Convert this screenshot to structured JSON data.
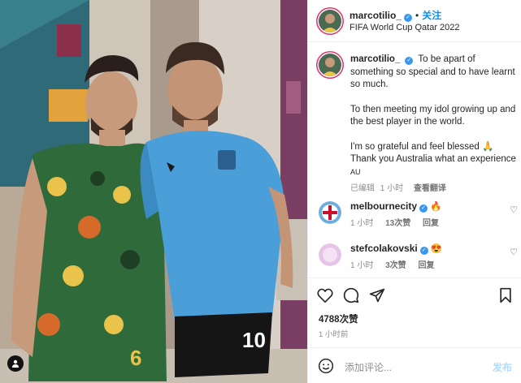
{
  "post": {
    "username": "marcotilio_",
    "follow_label": "关注",
    "location": "FIFA World Cup Qatar 2022",
    "jersey_number": "10"
  },
  "caption": {
    "username": "marcotilio_",
    "line1": "To be apart of something so special and to have learnt so much.",
    "line2": "To then meeting my idol growing up and the best player in the world.",
    "line3": "I'm so grateful and feel blessed",
    "line3_emoji": "🙏",
    "line4": "Thank you Australia what an experience",
    "line4_flag": "AU",
    "edited": "已编辑",
    "time": "1 小时",
    "translate": "查看翻译"
  },
  "comments": [
    {
      "username": "melbournecity",
      "emoji": "🔥",
      "time": "1 小时",
      "likes": "13次赞",
      "reply": "回复"
    },
    {
      "username": "stefcolakovski",
      "emoji": "😍",
      "time": "1 小时",
      "likes": "3次赞",
      "reply": "回复"
    }
  ],
  "actions": {
    "like": "heart-icon",
    "comment": "comment-icon",
    "share": "share-icon",
    "save": "bookmark-icon"
  },
  "likes_count": "4788次赞",
  "posted_time": "1 小时前",
  "add_comment": {
    "placeholder": "添加评论...",
    "post_label": "发布"
  },
  "colors": {
    "verified": "#3897f0",
    "follow": "#0095f6",
    "argentina_shirt": "#4a9fd8",
    "australia_shirt": "#2f6b3a"
  }
}
